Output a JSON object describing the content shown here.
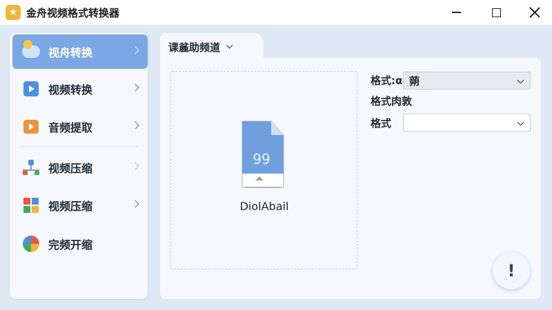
{
  "window": {
    "title": "金舟视频格式转换器",
    "app_icon": "star-app-icon",
    "controls": [
      "minimize",
      "maximize",
      "close"
    ]
  },
  "sidebar": {
    "items": [
      {
        "label": "视舟转换",
        "icon": "cloud-sun-icon",
        "active": true
      },
      {
        "label": "视频转换",
        "icon": "video-play-icon",
        "active": false
      },
      {
        "label": "音频提取",
        "icon": "audio-extract-icon",
        "active": false
      },
      {
        "label": "视频压缩",
        "icon": "network-icon",
        "active": false
      },
      {
        "label": "视频压缩",
        "icon": "grid-icon",
        "active": false
      },
      {
        "label": "完频开缩",
        "icon": "color-wheel-icon",
        "active": false
      }
    ]
  },
  "main": {
    "tab": {
      "label": "课麄助频道"
    },
    "dropzone": {
      "file_badge": "99",
      "file_label": "DiolAbail"
    },
    "form": {
      "row1_label": "格式:α",
      "row1_value": "蒴",
      "row2_label": "格式肉敦",
      "row3_label": "格式",
      "row3_value": ""
    },
    "fab_symbol": "!"
  },
  "colors": {
    "accent": "#7aa8e4",
    "background": "#dfe9f5",
    "panel": "#f5f8fc"
  }
}
